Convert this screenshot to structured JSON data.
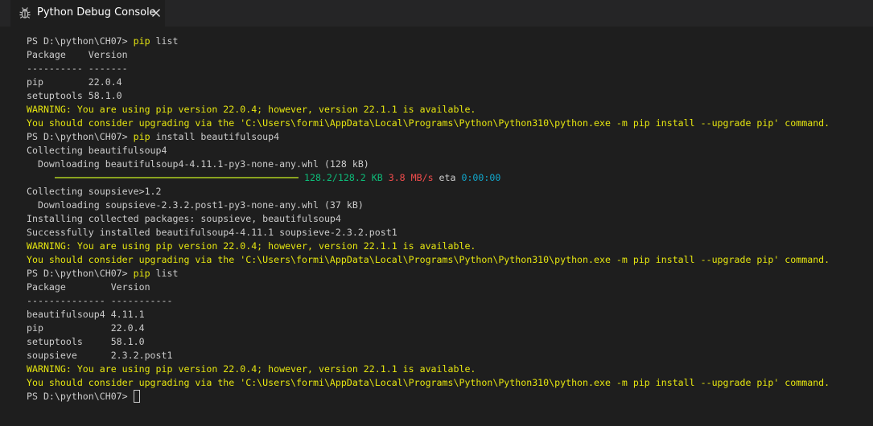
{
  "tab": {
    "label": "Python Debug Console",
    "icon": "bug-icon",
    "close_icon": "close-icon"
  },
  "colors": {
    "background": "#1e1e1e",
    "text": "#cccccc",
    "warning": "#e5e510",
    "progress": "#8aa320",
    "progress_text": "#0dbc79",
    "speed": "#f14c4c",
    "eta": "#11a8cd"
  },
  "terminal": {
    "lines": [
      {
        "segments": [
          {
            "text": "PS D:\\python\\CH07> ",
            "style": ""
          },
          {
            "text": "pip",
            "style": "cmd"
          },
          {
            "text": " list",
            "style": ""
          }
        ]
      },
      {
        "segments": [
          {
            "text": "Package    Version",
            "style": ""
          }
        ]
      },
      {
        "segments": [
          {
            "text": "---------- -------",
            "style": ""
          }
        ]
      },
      {
        "segments": [
          {
            "text": "pip        22.0.4",
            "style": ""
          }
        ]
      },
      {
        "segments": [
          {
            "text": "setuptools 58.1.0",
            "style": ""
          }
        ]
      },
      {
        "segments": [
          {
            "text": "WARNING: You are using pip version 22.0.4; however, version 22.1.1 is available.",
            "style": "yellow"
          }
        ]
      },
      {
        "segments": [
          {
            "text": "You should consider upgrading via the 'C:\\Users\\formi\\AppData\\Local\\Programs\\Python\\Python310\\python.exe -m pip install --upgrade pip' command.",
            "style": "yellow"
          }
        ]
      },
      {
        "segments": [
          {
            "text": "PS D:\\python\\CH07> ",
            "style": ""
          },
          {
            "text": "pip",
            "style": "cmd"
          },
          {
            "text": " install beautifulsoup4",
            "style": ""
          }
        ]
      },
      {
        "segments": [
          {
            "text": "Collecting beautifulsoup4",
            "style": ""
          }
        ]
      },
      {
        "segments": [
          {
            "text": "  Downloading beautifulsoup4-4.11.1-py3-none-any.whl (128 kB)",
            "style": ""
          }
        ]
      },
      {
        "progress": true,
        "segments": [
          {
            "text": "128.2/128.2 KB",
            "style": "green"
          },
          {
            "text": " ",
            "style": ""
          },
          {
            "text": "3.8 MB/s",
            "style": "red"
          },
          {
            "text": " eta ",
            "style": ""
          },
          {
            "text": "0:00:00",
            "style": "cyan"
          }
        ]
      },
      {
        "segments": [
          {
            "text": "Collecting soupsieve>1.2",
            "style": ""
          }
        ]
      },
      {
        "segments": [
          {
            "text": "  Downloading soupsieve-2.3.2.post1-py3-none-any.whl (37 kB)",
            "style": ""
          }
        ]
      },
      {
        "segments": [
          {
            "text": "Installing collected packages: soupsieve, beautifulsoup4",
            "style": ""
          }
        ]
      },
      {
        "segments": [
          {
            "text": "Successfully installed beautifulsoup4-4.11.1 soupsieve-2.3.2.post1",
            "style": ""
          }
        ]
      },
      {
        "segments": [
          {
            "text": "WARNING: You are using pip version 22.0.4; however, version 22.1.1 is available.",
            "style": "yellow"
          }
        ]
      },
      {
        "segments": [
          {
            "text": "You should consider upgrading via the 'C:\\Users\\formi\\AppData\\Local\\Programs\\Python\\Python310\\python.exe -m pip install --upgrade pip' command.",
            "style": "yellow"
          }
        ]
      },
      {
        "segments": [
          {
            "text": "PS D:\\python\\CH07> ",
            "style": ""
          },
          {
            "text": "pip",
            "style": "cmd"
          },
          {
            "text": " list",
            "style": ""
          }
        ]
      },
      {
        "segments": [
          {
            "text": "Package        Version",
            "style": ""
          }
        ]
      },
      {
        "segments": [
          {
            "text": "-------------- -----------",
            "style": ""
          }
        ]
      },
      {
        "segments": [
          {
            "text": "beautifulsoup4 4.11.1",
            "style": ""
          }
        ]
      },
      {
        "segments": [
          {
            "text": "pip            22.0.4",
            "style": ""
          }
        ]
      },
      {
        "segments": [
          {
            "text": "setuptools     58.1.0",
            "style": ""
          }
        ]
      },
      {
        "segments": [
          {
            "text": "soupsieve      2.3.2.post1",
            "style": ""
          }
        ]
      },
      {
        "segments": [
          {
            "text": "WARNING: You are using pip version 22.0.4; however, version 22.1.1 is available.",
            "style": "yellow"
          }
        ]
      },
      {
        "segments": [
          {
            "text": "You should consider upgrading via the 'C:\\Users\\formi\\AppData\\Local\\Programs\\Python\\Python310\\python.exe -m pip install --upgrade pip' command.",
            "style": "yellow"
          }
        ]
      },
      {
        "cursor": true,
        "segments": [
          {
            "text": "PS D:\\python\\CH07> ",
            "style": ""
          }
        ]
      }
    ]
  },
  "download_progress": 1.0
}
